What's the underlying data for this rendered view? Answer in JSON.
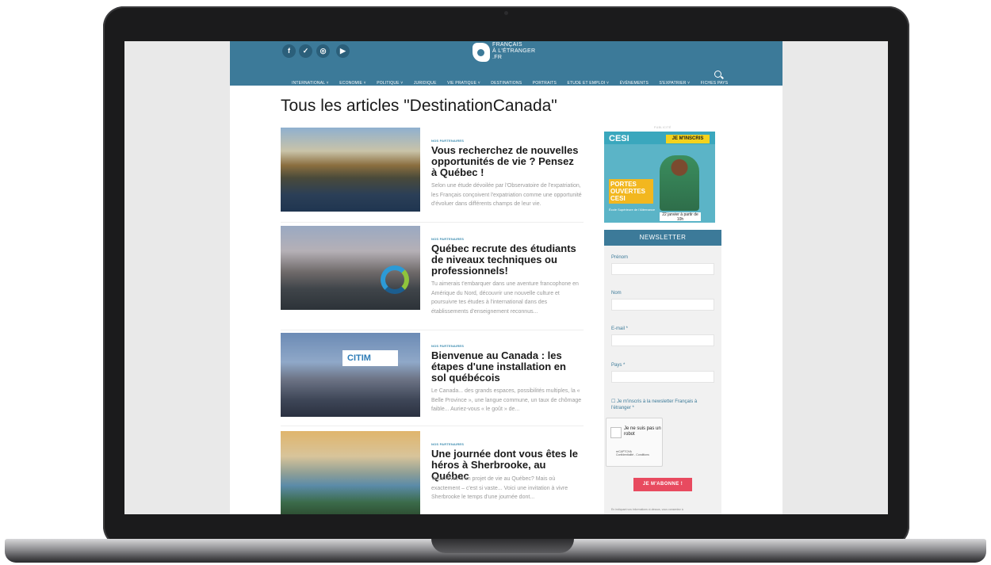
{
  "site": {
    "logo": {
      "line1": "FRANÇAIS",
      "line2": "À L'ÉTRANGER",
      "line3": ".FR"
    },
    "social": [
      {
        "icon": "facebook-icon",
        "glyph": "f"
      },
      {
        "icon": "twitter-icon",
        "glyph": "✓"
      },
      {
        "icon": "instagram-icon",
        "glyph": "◎"
      },
      {
        "icon": "youtube-icon",
        "glyph": "▶"
      }
    ],
    "nav": [
      "INTERNATIONAL ˅",
      "ECONOMIE ˅",
      "POLITIQUE ˅",
      "JURIDIQUE",
      "VIE PRATIQUE ˅",
      "DESTINATIONS",
      "PORTRAITS",
      "ETUDE ET EMPLOI ˅",
      "ÉVÉNEMENTS",
      "S'EXPATRIER ˅",
      "FICHES PAYS"
    ],
    "page_title": "Tous les articles \"DestinationCanada\"",
    "articles": [
      {
        "category": "NOS PARTENAIRES",
        "title": "Vous recherchez de nouvelles opportunités de vie ? Pensez à Québec !",
        "excerpt": "Selon une étude dévoilée par l'Observatoire de l'expatriation, les Français conçoivent l'expatriation comme une opportunité d'évoluer dans différents champs de leur vie."
      },
      {
        "category": "NOS PARTENAIRES",
        "title": "Québec recrute des étudiants de niveaux techniques ou professionnels!",
        "excerpt": "Tu aimerais t'embarquer dans une aventure francophone en Amérique du Nord, découvrir une nouvelle culture et poursuivre tes études à l'international dans des établissements d'enseignement reconnus..."
      },
      {
        "category": "NOS PARTENAIRES",
        "title": "Bienvenue au Canada : les étapes d'une installation en sol québécois",
        "excerpt": "Le Canada... des grands espaces, possibilités multiples, la « Belle Province », une langue commune, un taux de chômage faible... Auriez-vous « le goût » de...",
        "badge": "CITIM"
      },
      {
        "category": "NOS PARTENAIRES",
        "title": "Une journée dont vous êtes le héros à Sherbrooke, au Québec",
        "excerpt": "Vous rêvez d'un projet de vie au Québec? Mais où exactement – c'est si vaste... Voici une invitation à vivre Sherbrooke le temps d'une journée dont..."
      }
    ],
    "sidebar": {
      "pub_label": "PUBLICITÉ",
      "ad": {
        "brand": "CESI",
        "cta": "JE M'INSCRIS",
        "headline": "PORTES OUVERTES CESI",
        "school": "École Supérieure de l'Alternance",
        "date": "22 janvier à partir de 10h"
      },
      "newsletter": {
        "title": "NEWSLETTER",
        "fields": [
          "Prénom",
          "Nom",
          "E-mail *",
          "Pays *"
        ],
        "consent": "Je m'inscris à la newsletter Français à l'étranger *",
        "captcha": {
          "text": "Je ne suis pas un robot",
          "brand": "reCAPTCHA",
          "links": "Confidentialité - Conditions"
        },
        "button": "JE M'ABONNE !",
        "fine_print": "En indiquant vos informations ci-dessus, vous consentez à"
      }
    }
  }
}
